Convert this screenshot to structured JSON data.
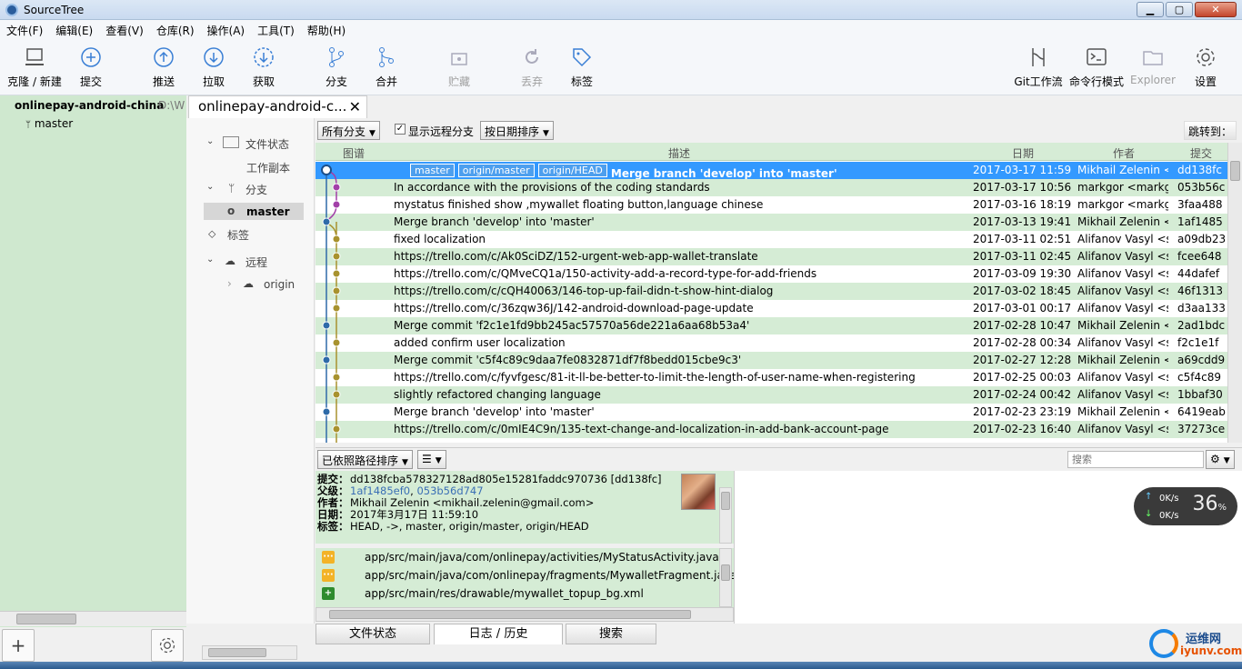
{
  "window": {
    "title": "SourceTree",
    "min": "▁",
    "max": "▢",
    "close": "✕"
  },
  "menu": [
    "文件(F)",
    "编辑(E)",
    "查看(V)",
    "仓库(R)",
    "操作(A)",
    "工具(T)",
    "帮助(H)"
  ],
  "toolbar": {
    "clone": "克隆 / 新建",
    "commit": "提交",
    "push": "推送",
    "pull": "拉取",
    "fetch": "获取",
    "branch": "分支",
    "merge": "合并",
    "stash": "贮藏",
    "discard": "丢弃",
    "tag": "标签",
    "gitflow": "Git工作流",
    "terminal": "命令行模式",
    "explorer": "Explorer",
    "settings": "设置"
  },
  "sidebar": {
    "repo": "onlinepay-android-china",
    "path": "D:\\W",
    "branch": "master",
    "add": "+"
  },
  "tab": {
    "title": "onlinepay-android-c...",
    "close": "✕"
  },
  "nav": {
    "file_status": "文件状态",
    "working_copy": "工作副本",
    "branches": "分支",
    "master": "master",
    "tags": "标签",
    "remotes": "远程",
    "origin": "origin"
  },
  "filter": {
    "all_branches": "所有分支",
    "show_remote": "显示远程分支",
    "sort_date": "按日期排序",
    "jump": "跳转到："
  },
  "columns": {
    "graph": "图谱",
    "desc": "描述",
    "date": "日期",
    "author": "作者",
    "commit": "提交"
  },
  "commits": [
    {
      "refs": [
        "master",
        "origin/master",
        "origin/HEAD"
      ],
      "desc": "Merge branch 'develop' into 'master'",
      "date": "2017-03-17 11:59",
      "author": "Mikhail Zelenin <",
      "hash": "dd138fc"
    },
    {
      "refs": [],
      "desc": "In accordance with the provisions of the coding standards",
      "date": "2017-03-17 10:56",
      "author": "markgor <markg",
      "hash": "053b56c"
    },
    {
      "refs": [],
      "desc": "mystatus finished show ,mywallet floating button,language chinese",
      "date": "2017-03-16 18:19",
      "author": "markgor <markg",
      "hash": "3faa488"
    },
    {
      "refs": [],
      "desc": "Merge branch 'develop' into 'master'",
      "date": "2017-03-13 19:41",
      "author": "Mikhail Zelenin <",
      "hash": "1af1485"
    },
    {
      "refs": [],
      "desc": "fixed localization",
      "date": "2017-03-11 02:51",
      "author": "Alifanov Vasyl <s",
      "hash": "a09db23"
    },
    {
      "refs": [],
      "desc": "https://trello.com/c/Ak0SciDZ/152-urgent-web-app-wallet-translate",
      "date": "2017-03-11 02:45",
      "author": "Alifanov Vasyl <s",
      "hash": "fcee648"
    },
    {
      "refs": [],
      "desc": "https://trello.com/c/QMveCQ1a/150-activity-add-a-record-type-for-add-friends",
      "date": "2017-03-09 19:30",
      "author": "Alifanov Vasyl <s",
      "hash": "44dafef"
    },
    {
      "refs": [],
      "desc": "https://trello.com/c/cQH40063/146-top-up-fail-didn-t-show-hint-dialog",
      "date": "2017-03-02 18:45",
      "author": "Alifanov Vasyl <s",
      "hash": "46f1313"
    },
    {
      "refs": [],
      "desc": "https://trello.com/c/36zqw36J/142-android-download-page-update",
      "date": "2017-03-01 00:17",
      "author": "Alifanov Vasyl <s",
      "hash": "d3aa133"
    },
    {
      "refs": [],
      "desc": "Merge commit 'f2c1e1fd9bb245ac57570a56de221a6aa68b53a4'",
      "date": "2017-02-28 10:47",
      "author": "Mikhail Zelenin <",
      "hash": "2ad1bdc"
    },
    {
      "refs": [],
      "desc": "added confirm user localization",
      "date": "2017-02-28 00:34",
      "author": "Alifanov Vasyl <s",
      "hash": "f2c1e1f"
    },
    {
      "refs": [],
      "desc": "Merge commit 'c5f4c89c9daa7fe0832871df7f8bedd015cbe9c3'",
      "date": "2017-02-27 12:28",
      "author": "Mikhail Zelenin <",
      "hash": "a69cdd9"
    },
    {
      "refs": [],
      "desc": "https://trello.com/c/fyvfgesc/81-it-ll-be-better-to-limit-the-length-of-user-name-when-registering",
      "date": "2017-02-25 00:03",
      "author": "Alifanov Vasyl <s",
      "hash": "c5f4c89"
    },
    {
      "refs": [],
      "desc": "slightly refactored changing language",
      "date": "2017-02-24 00:42",
      "author": "Alifanov Vasyl <s",
      "hash": "1bbaf30"
    },
    {
      "refs": [],
      "desc": "Merge branch 'develop' into 'master'",
      "date": "2017-02-23 23:19",
      "author": "Mikhail Zelenin <",
      "hash": "6419eab"
    },
    {
      "refs": [],
      "desc": "https://trello.com/c/0mIE4C9n/135-text-change-and-localization-in-add-bank-account-page",
      "date": "2017-02-23 16:40",
      "author": "Alifanov Vasyl <s",
      "hash": "37273ce"
    }
  ],
  "lower": {
    "sort_path": "已依照路径排序",
    "list_icon": "☰",
    "search_placeholder": "搜索"
  },
  "detail": {
    "commit_label": "提交：",
    "commit": "dd138fcba578327128ad805e15281faddc970736 [dd138fc]",
    "parents_label": "父级：",
    "parent1": "1af1485ef0",
    "parent2": "053b56d747",
    "author_label": "作者：",
    "author": "Mikhail Zelenin <mikhail.zelenin@gmail.com>",
    "date_label": "日期：",
    "date": "2017年3月17日 11:59:10",
    "tags_label": "标签：",
    "tags": "HEAD, ->, master, origin/master, origin/HEAD"
  },
  "files": [
    {
      "status": "modified",
      "path": "app/src/main/java/com/onlinepay/activities/MyStatusActivity.java"
    },
    {
      "status": "modified",
      "path": "app/src/main/java/com/onlinepay/fragments/MywalletFragment.java"
    },
    {
      "status": "added",
      "path": "app/src/main/res/drawable/mywallet_topup_bg.xml"
    }
  ],
  "bottom_tabs": {
    "file_status": "文件状态",
    "log": "日志 / 历史",
    "search": "搜索"
  },
  "net": {
    "up": "0K/s",
    "down": "0K/s",
    "percent": "36",
    "unit": "%"
  },
  "watermark": {
    "line1": "运维网",
    "line2": "iyunv.com"
  },
  "colors": {
    "selection": "#3399ff",
    "row_alt": "#d5ecd5",
    "graph_blue": "#2e6aa8",
    "graph_purple": "#a23fa8",
    "graph_olive": "#a8922e"
  }
}
